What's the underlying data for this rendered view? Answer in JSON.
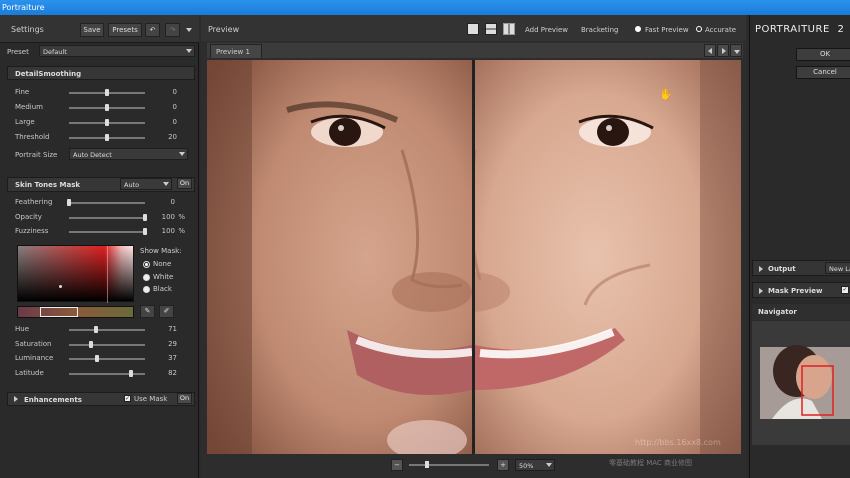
{
  "window": {
    "title": "Portraiture"
  },
  "settings": {
    "title": "Settings",
    "save_label": "Save",
    "presets_label": "Presets",
    "preset_label": "Preset",
    "preset_value": "Default"
  },
  "detail_smoothing": {
    "title": "DetailSmoothing",
    "sliders": [
      {
        "label": "Fine",
        "value": "0",
        "fraction": 0.5
      },
      {
        "label": "Medium",
        "value": "0",
        "fraction": 0.5
      },
      {
        "label": "Large",
        "value": "0",
        "fraction": 0.5
      },
      {
        "label": "Threshold",
        "value": "20",
        "fraction": 0.5
      }
    ],
    "portrait_size_label": "Portrait Size",
    "portrait_size_value": "Auto Detect"
  },
  "skin_tones_mask": {
    "title": "Skin Tones Mask",
    "mode_value": "Auto",
    "on_label": "On",
    "sliders": [
      {
        "label": "Feathering",
        "value": "0",
        "unit": "",
        "fraction": 0.0
      },
      {
        "label": "Opacity",
        "value": "100",
        "unit": "%",
        "fraction": 1.0
      },
      {
        "label": "Fuzziness",
        "value": "100",
        "unit": "%",
        "fraction": 1.0
      }
    ],
    "show_mask_label": "Show Mask:",
    "show_mask_options": [
      "None",
      "White",
      "Black"
    ],
    "show_mask_selected": "None",
    "color_sliders": [
      {
        "label": "Hue",
        "value": "71",
        "fraction": 0.35
      },
      {
        "label": "Saturation",
        "value": "29",
        "fraction": 0.29
      },
      {
        "label": "Luminance",
        "value": "37",
        "fraction": 0.37
      },
      {
        "label": "Latitude",
        "value": "82",
        "fraction": 0.82
      }
    ]
  },
  "enhancements": {
    "title": "Enhancements",
    "use_mask_label": "Use Mask",
    "on_label": "On"
  },
  "preview": {
    "title": "Preview",
    "add_preview_label": "Add Preview",
    "bracketing_label": "Bracketing",
    "fast_preview_label": "Fast Preview",
    "accurate_label": "Accurate",
    "tab_label": "Preview 1",
    "zoom_value": "50%"
  },
  "right_panel": {
    "brand": "PORTRAITURE",
    "version": "2",
    "ok_label": "OK",
    "cancel_label": "Cancel",
    "output_label": "Output",
    "output_value": "New La",
    "mask_preview_label": "Mask Preview",
    "navigator_label": "Navigator"
  },
  "watermark": {
    "url": "http://bbs.16xx8.com",
    "caption": "零基础教程  MAC 商业修图"
  },
  "colors": {
    "titlebar": "#1e88e5",
    "panel": "#2a2a2a",
    "navigator_box": "#e02020"
  }
}
